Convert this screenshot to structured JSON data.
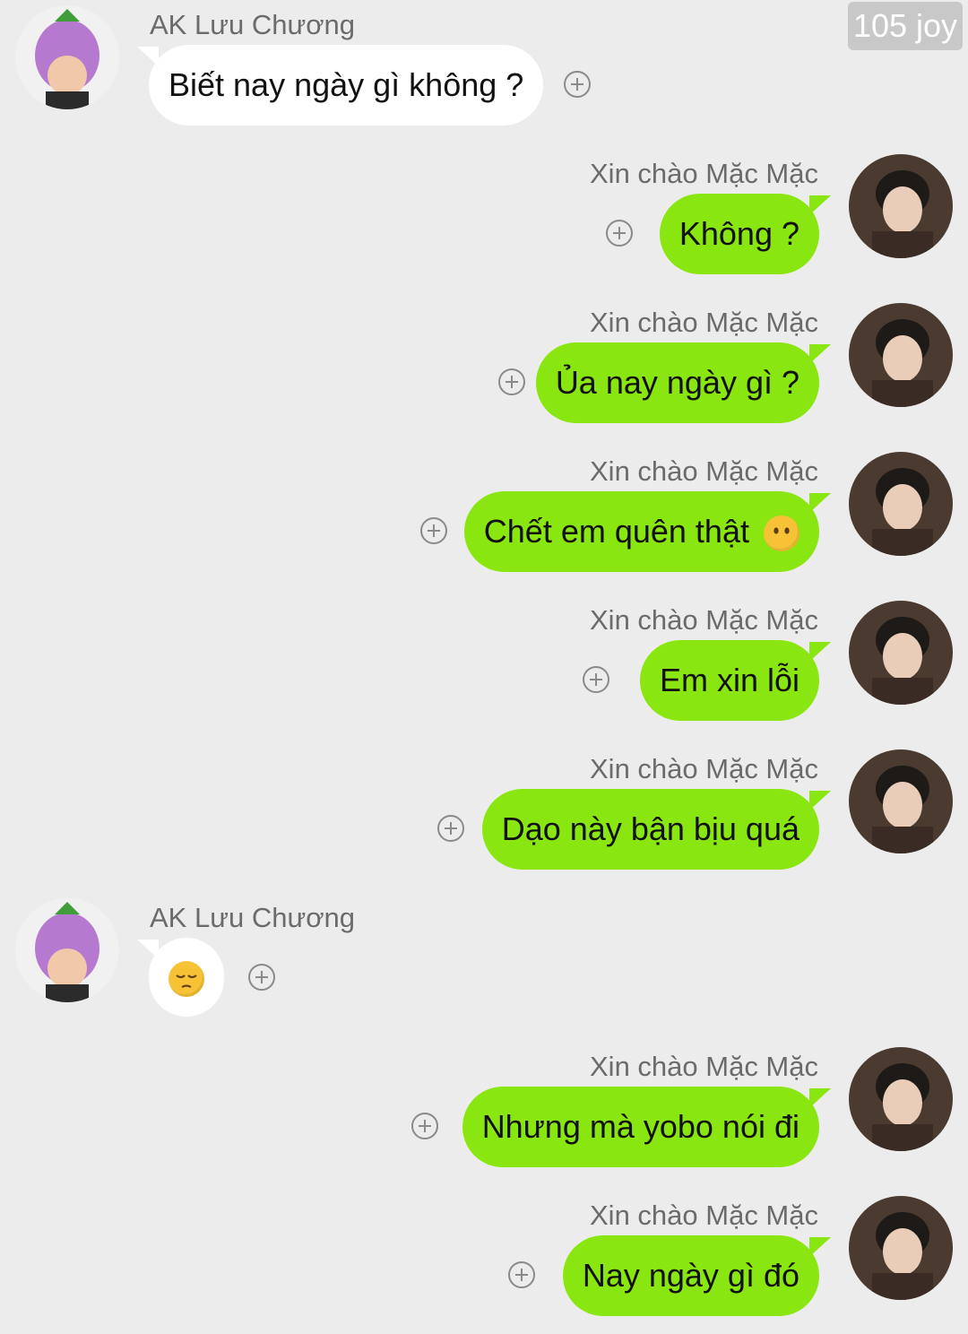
{
  "watermark": "105 joy",
  "colors": {
    "background": "#ececec",
    "incoming_bubble": "#ffffff",
    "outgoing_bubble": "#8ae610",
    "name_text": "#6b6b6b"
  },
  "contact": {
    "name": "AK Lưu Chương",
    "avatar_icon": "eggplant-hat-avatar"
  },
  "me": {
    "name": "Xin chào Mặc Mặc",
    "avatar_icon": "profile-photo-avatar"
  },
  "messages": [
    {
      "sender": "AK Lưu Chương",
      "direction": "in",
      "text": "Biết nay ngày gì không ?"
    },
    {
      "sender": "Xin chào Mặc Mặc",
      "direction": "out",
      "text": "Không ?"
    },
    {
      "sender": "Xin chào Mặc Mặc",
      "direction": "out",
      "text": "Ủa nay ngày gì ?"
    },
    {
      "sender": "Xin chào Mặc Mặc",
      "direction": "out",
      "text": "Chết em quên thật",
      "emoji": "neutral-face-emoji"
    },
    {
      "sender": "Xin chào Mặc Mặc",
      "direction": "out",
      "text": "Em xin lỗi"
    },
    {
      "sender": "Xin chào Mặc Mặc",
      "direction": "out",
      "text": "Dạo này bận bịu quá"
    },
    {
      "sender": "AK Lưu Chương",
      "direction": "in",
      "text": "",
      "emoji": "pensive-face-emoji"
    },
    {
      "sender": "Xin chào Mặc Mặc",
      "direction": "out",
      "text": "Nhưng mà yobo nói đi"
    },
    {
      "sender": "Xin chào Mặc Mặc",
      "direction": "out",
      "text": "Nay ngày gì đó"
    }
  ],
  "reaction_button_icon": "plus-circle-icon"
}
